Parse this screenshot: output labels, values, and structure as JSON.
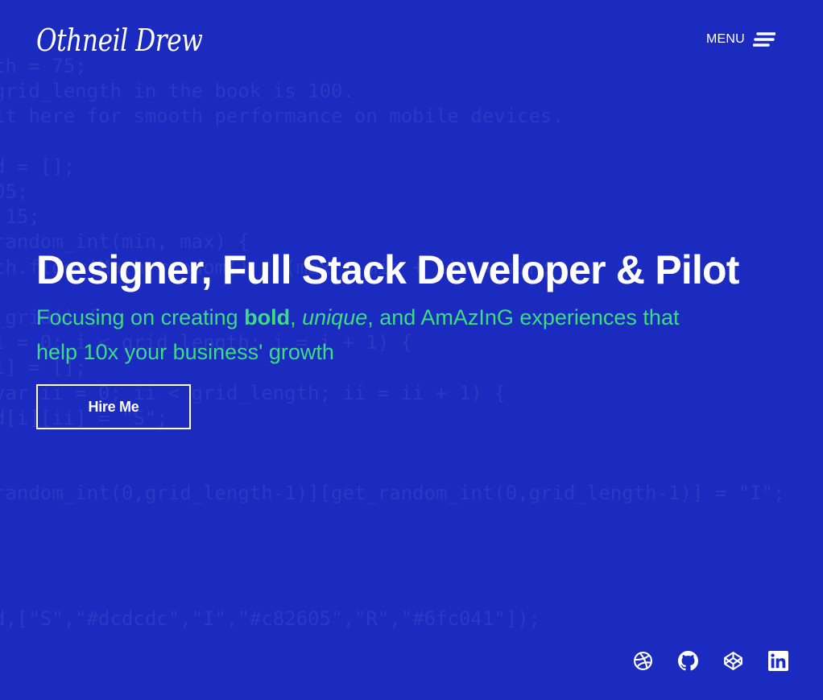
{
  "brand": {
    "logo_text": "Othneil Drew"
  },
  "nav": {
    "menu_label": "MENU",
    "menu_icon": "hamburger-menu-icon"
  },
  "hero": {
    "headline": "Designer, Full Stack Developer & Pilot",
    "subline": {
      "part1": "Focusing on creating ",
      "bold": "bold",
      "part2": ", ",
      "italic": "unique",
      "part3": ", and AmAzInG experiences that help 10x your business' growth"
    },
    "cta_label": "Hire Me"
  },
  "background_code": [
    "th = 75;",
    "grid_length in the book is 100.",
    "it here for smooth performance on mobile devices.",
    "",
    "d = [];",
    "05;",
    " 15;",
    "random_int(min, max) {",
    "th.floor(Math.random() * (max - min + 1)) + min;",
    "",
    "_grid() {",
    "i = 0; i < grid_length; i = i + 1) {",
    "i] = [];",
    "var ii = 0; ii < grid_length; ii = ii + 1) {",
    "d[i][ii] = \"S\";",
    "",
    "",
    "random_int(0,grid_length-1)][get_random_int(0,grid_length-1)] = \"I\";",
    "",
    "",
    "",
    "",
    "d,[\"S\",\"#dcdcdc\",\"I\",\"#c82605\",\"R\",\"#6fc041\"]);"
  ],
  "socials": [
    {
      "name": "dribbble-icon",
      "label": "Dribbble"
    },
    {
      "name": "github-icon",
      "label": "GitHub"
    },
    {
      "name": "codepen-icon",
      "label": "CodePen"
    },
    {
      "name": "linkedin-icon",
      "label": "LinkedIn"
    }
  ],
  "colors": {
    "background": "#1b2abf",
    "accent": "#3ddc84",
    "text": "#ffffff"
  }
}
